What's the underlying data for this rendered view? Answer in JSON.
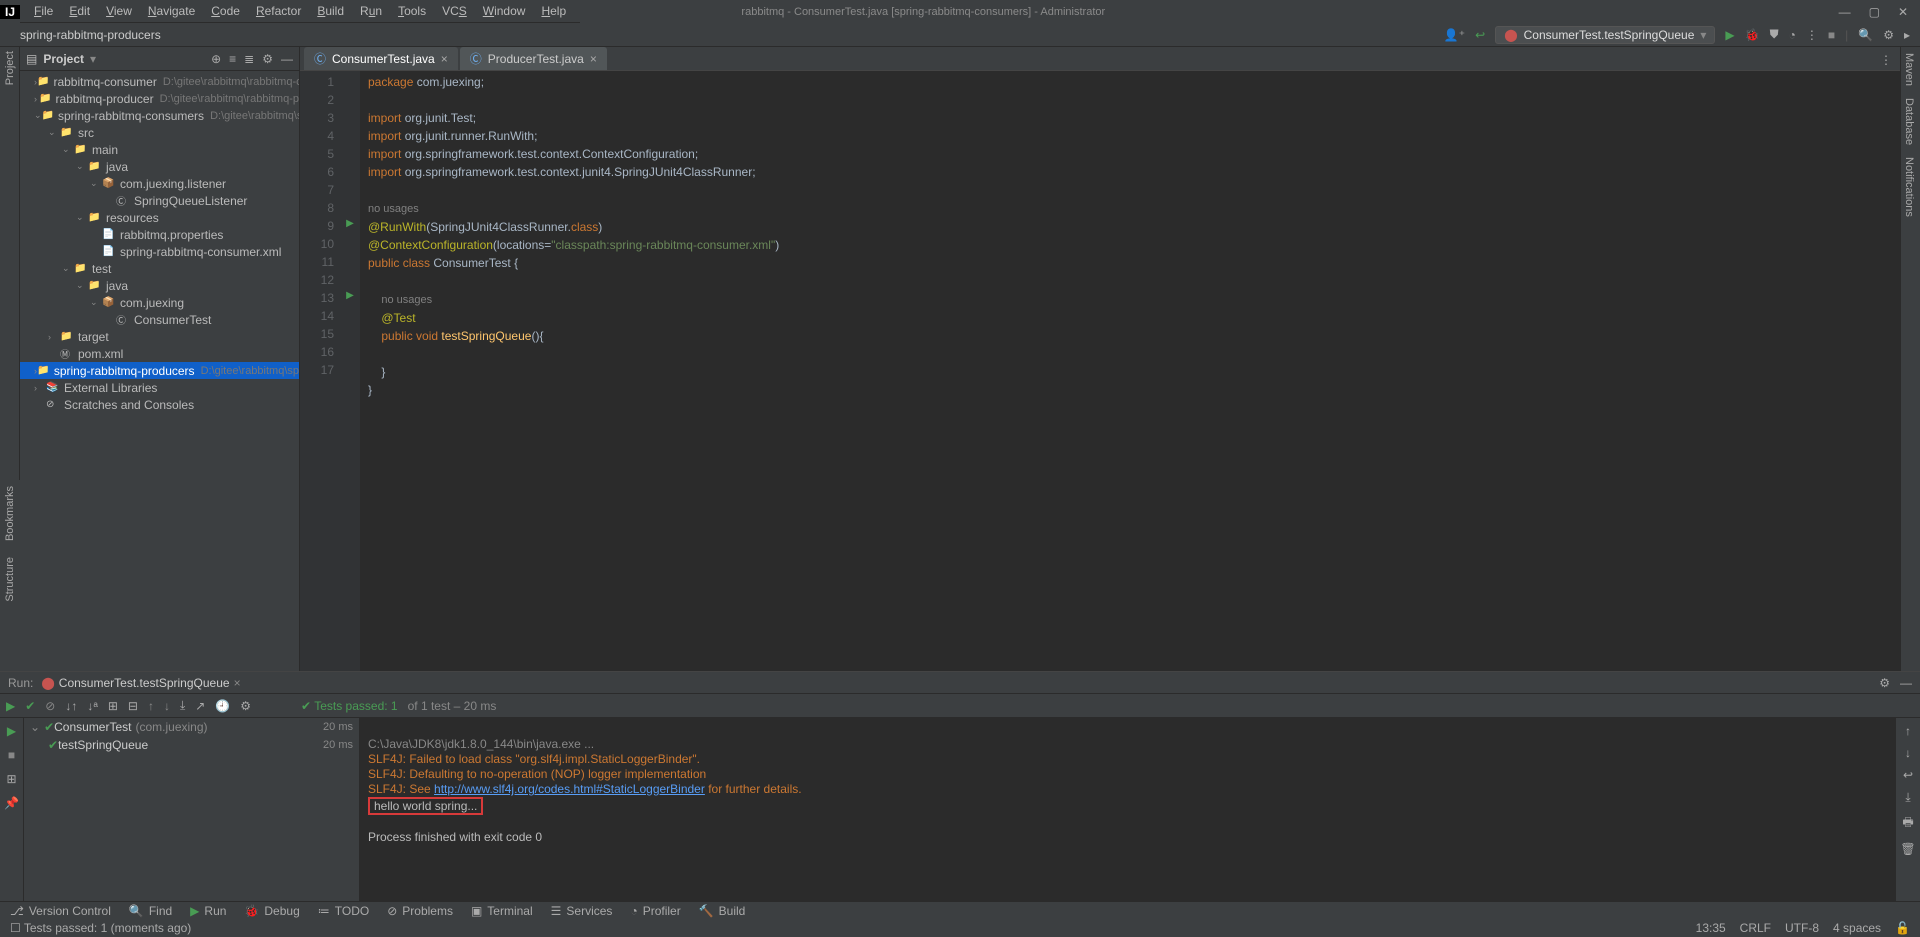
{
  "titlebar": {
    "title": "rabbitmq - ConsumerTest.java [spring-rabbitmq-consumers] - Administrator"
  },
  "menu": {
    "file": "File",
    "edit": "Edit",
    "view": "View",
    "navigate": "Navigate",
    "code": "Code",
    "refactor": "Refactor",
    "build": "Build",
    "run": "Run",
    "tools": "Tools",
    "vcs": "VCS",
    "window": "Window",
    "help": "Help"
  },
  "crumb": {
    "root": "spring-rabbitmq-producers"
  },
  "toolbar": {
    "run_config": "ConsumerTest.testSpringQueue"
  },
  "project": {
    "label": "Project",
    "items": [
      {
        "indent": 1,
        "arrow": "›",
        "icon": "📁",
        "name": "rabbitmq-consumer",
        "path": "D:\\gitee\\rabbitmq\\rabbitmq-c"
      },
      {
        "indent": 1,
        "arrow": "›",
        "icon": "📁",
        "name": "rabbitmq-producer",
        "path": "D:\\gitee\\rabbitmq\\rabbitmq-p"
      },
      {
        "indent": 1,
        "arrow": "⌄",
        "icon": "📁",
        "name": "spring-rabbitmq-consumers",
        "path": "D:\\gitee\\rabbitmq\\sp"
      },
      {
        "indent": 2,
        "arrow": "⌄",
        "icon": "📁",
        "name": "src",
        "path": ""
      },
      {
        "indent": 3,
        "arrow": "⌄",
        "icon": "📁",
        "name": "main",
        "path": ""
      },
      {
        "indent": 4,
        "arrow": "⌄",
        "icon": "📁",
        "name": "java",
        "path": ""
      },
      {
        "indent": 5,
        "arrow": "⌄",
        "icon": "📦",
        "name": "com.juexing.listener",
        "path": ""
      },
      {
        "indent": 6,
        "arrow": "",
        "icon": "Ⓒ",
        "name": "SpringQueueListener",
        "path": ""
      },
      {
        "indent": 4,
        "arrow": "⌄",
        "icon": "📁",
        "name": "resources",
        "path": ""
      },
      {
        "indent": 5,
        "arrow": "",
        "icon": "📄",
        "name": "rabbitmq.properties",
        "path": ""
      },
      {
        "indent": 5,
        "arrow": "",
        "icon": "📄",
        "name": "spring-rabbitmq-consumer.xml",
        "path": ""
      },
      {
        "indent": 3,
        "arrow": "⌄",
        "icon": "📁",
        "name": "test",
        "path": ""
      },
      {
        "indent": 4,
        "arrow": "⌄",
        "icon": "📁",
        "name": "java",
        "path": ""
      },
      {
        "indent": 5,
        "arrow": "⌄",
        "icon": "📦",
        "name": "com.juexing",
        "path": ""
      },
      {
        "indent": 6,
        "arrow": "",
        "icon": "Ⓒ",
        "name": "ConsumerTest",
        "path": ""
      },
      {
        "indent": 2,
        "arrow": "›",
        "icon": "📁",
        "name": "target",
        "path": ""
      },
      {
        "indent": 2,
        "arrow": "",
        "icon": "Ⓜ",
        "name": "pom.xml",
        "path": ""
      },
      {
        "indent": 1,
        "arrow": "›",
        "icon": "📁",
        "name": "spring-rabbitmq-producers",
        "path": "D:\\gitee\\rabbitmq\\sp",
        "sel": true
      },
      {
        "indent": 1,
        "arrow": "›",
        "icon": "📚",
        "name": "External Libraries",
        "path": ""
      },
      {
        "indent": 1,
        "arrow": "",
        "icon": "⊘",
        "name": "Scratches and Consoles",
        "path": ""
      }
    ]
  },
  "tabs": {
    "t1": "ConsumerTest.java",
    "t2": "ProducerTest.java"
  },
  "code": {
    "lines": [
      1,
      2,
      3,
      4,
      5,
      6,
      7,
      8,
      9,
      10,
      11,
      12,
      13,
      14,
      15,
      16,
      17
    ],
    "l1_kw": "package ",
    "l1_t": "com.juexing;",
    "l3_kw": "import ",
    "l3_t": "org.junit.Test;",
    "l4_kw": "import ",
    "l4_t": "org.junit.runner.RunWith;",
    "l5_kw": "import ",
    "l5_t1": "org.springframework.test.context.",
    "l5_cls": "ContextConfiguration",
    "l5_t2": ";",
    "l6_kw": "import ",
    "l6_t1": "org.springframework.test.context.junit4.",
    "l6_cls": "SpringJUnit4ClassRunner",
    "l6_t2": ";",
    "nousages": "no usages",
    "l8_ann": "@RunWith",
    "l8_t1": "(SpringJUnit4ClassRunner.",
    "l8_kw": "class",
    "l8_t2": ")",
    "l9_ann": "@ContextConfiguration",
    "l9_t1": "(locations=",
    "l9_str": "\"classpath:spring-rabbitmq-consumer.xml\"",
    "l9_t2": ")",
    "l10_kw": "public class ",
    "l10_cls": "ConsumerTest ",
    "l10_t": "{",
    "l12_ann": "@Test",
    "l13_kw1": "public ",
    "l13_kw2": "void ",
    "l13_fn": "testSpringQueue",
    "l13_t": "(){",
    "l15_t": "}",
    "l16_t": "}"
  },
  "run": {
    "header_label": "Run:",
    "header_name": "ConsumerTest.testSpringQueue",
    "pass_prefix": "Tests passed: 1",
    "pass_suffix": " of 1 test – 20 ms",
    "tree_root": "ConsumerTest",
    "tree_pkg": "(com.juexing)",
    "tree_root_time": "20 ms",
    "tree_child": "testSpringQueue",
    "tree_child_time": "20 ms"
  },
  "console": {
    "l1": "C:\\Java\\JDK8\\jdk1.8.0_144\\bin\\java.exe ...",
    "l2": "SLF4J: Failed to load class \"org.slf4j.impl.StaticLoggerBinder\".",
    "l3": "SLF4J: Defaulting to no-operation (NOP) logger implementation",
    "l4a": "SLF4J: See ",
    "l4link": "http://www.slf4j.org/codes.html#StaticLoggerBinder",
    "l4b": " for further details.",
    "l5": "hello world spring...",
    "l7": "Process finished with exit code 0"
  },
  "bottombar": {
    "vcs": "Version Control",
    "find": "Find",
    "run": "Run",
    "debug": "Debug",
    "todo": "TODO",
    "problems": "Problems",
    "terminal": "Terminal",
    "services": "Services",
    "profiler": "Profiler",
    "build": "Build"
  },
  "status": {
    "msg": "Tests passed: 1 (moments ago)",
    "pos": "13:35",
    "eol": "CRLF",
    "enc": "UTF-8",
    "ind": "4 spaces"
  },
  "rightbar": {
    "maven": "Maven",
    "db": "Database",
    "notif": "Notifications"
  },
  "leftbar": {
    "project": "Project",
    "bookmarks": "Bookmarks",
    "structure": "Structure"
  }
}
